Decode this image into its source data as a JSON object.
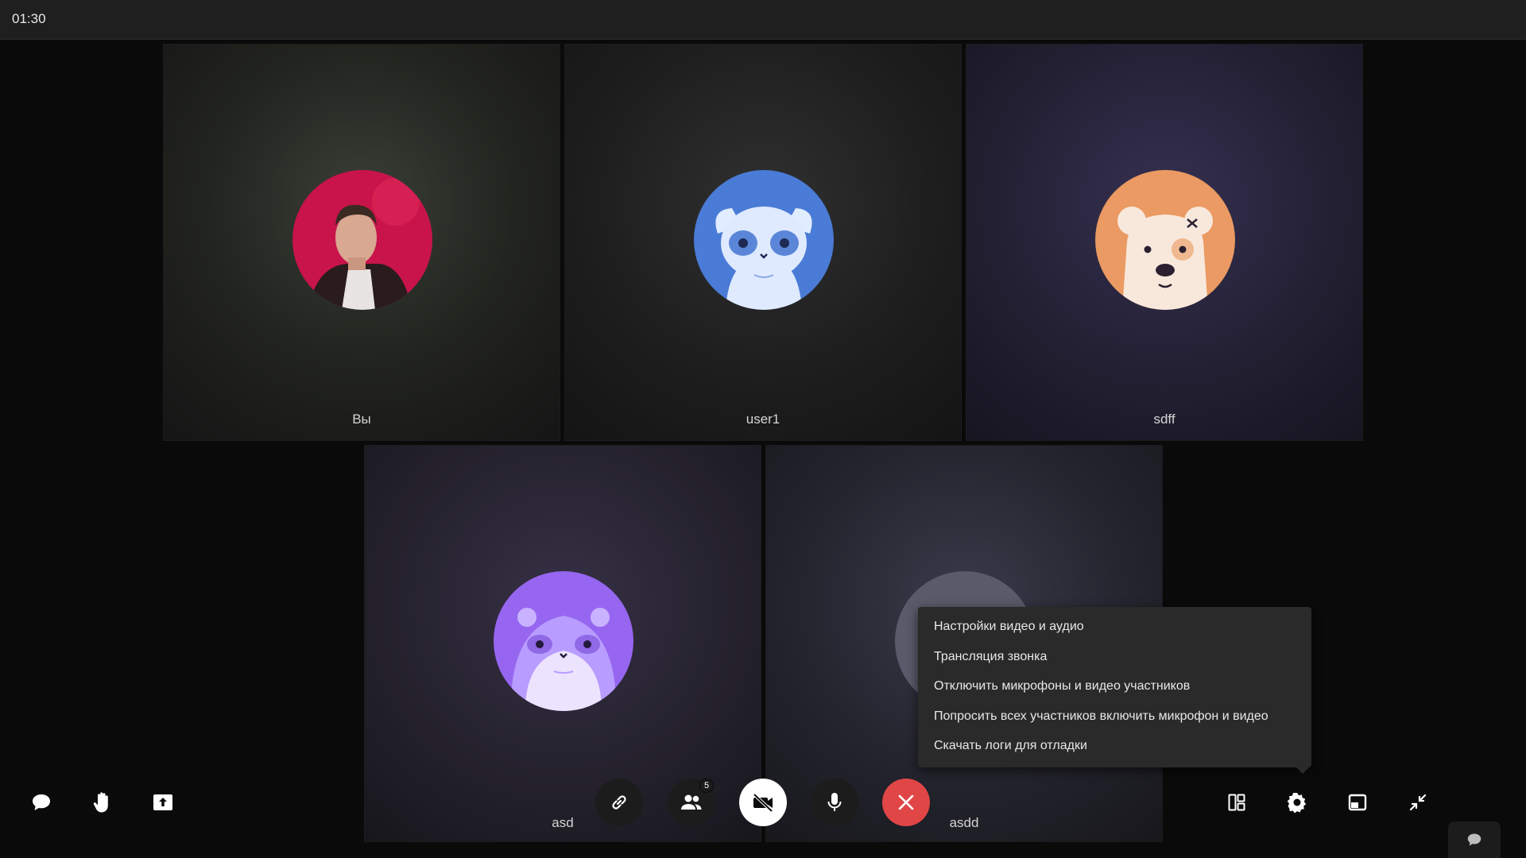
{
  "header": {
    "timer": "01:30"
  },
  "participants": [
    {
      "name": "Вы",
      "avatar": "photo-avatar"
    },
    {
      "name": "user1",
      "avatar": "lemur-avatar"
    },
    {
      "name": "sdff",
      "avatar": "bear-avatar"
    },
    {
      "name": "asd",
      "avatar": "hamster-avatar"
    },
    {
      "name": "asdd",
      "avatar": "placeholder-avatar"
    }
  ],
  "menu": {
    "items": [
      "Настройки видео и аудио",
      "Трансляция звонка",
      "Отключить микрофоны и видео участников",
      "Попросить всех участников включить микрофон и видео",
      "Скачать логи для отладки"
    ]
  },
  "controls": {
    "participants_count": "5",
    "colors": {
      "end_call": "#e04646",
      "camera_off_bg": "#ffffff",
      "button_bg": "#1c1c1c"
    }
  }
}
